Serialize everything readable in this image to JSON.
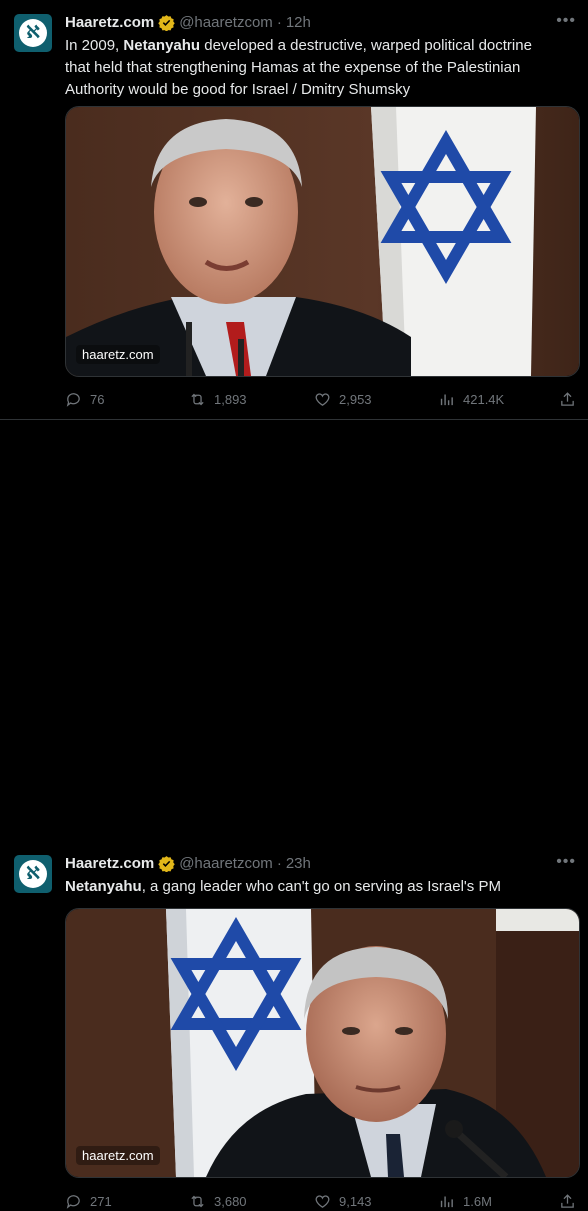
{
  "tweets": [
    {
      "name": "Haaretz.com",
      "handle": "@haaretzcom",
      "time": "12h",
      "text_bold": "Netanyahu",
      "text_pre": "In 2009, ",
      "text_post": " developed a destructive, warped political doctrine that held that strengthening Hamas at the expense of the Palestinian Authority would be good for Israel / Dmitry Shumsky",
      "media_domain": "haaretz.com",
      "replies": "76",
      "retweets": "1,893",
      "likes": "2,953",
      "views": "421.4K"
    },
    {
      "name": "Haaretz.com",
      "handle": "@haaretzcom",
      "time": "23h",
      "text_bold": "Netanyahu",
      "text_pre": "",
      "text_post": ", a gang leader who can't go on serving as Israel's PM",
      "media_domain": "haaretz.com",
      "replies": "271",
      "retweets": "3,680",
      "likes": "9,143",
      "views": "1.6M"
    }
  ],
  "colors": {
    "background": "#000000",
    "text": "#e7e9ea",
    "muted": "#71767b",
    "verified": "#e2b719",
    "avatar": "#0f5f6e"
  }
}
